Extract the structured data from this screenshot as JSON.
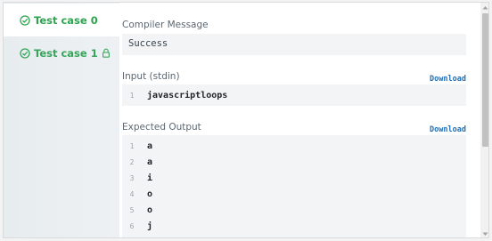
{
  "tabs": [
    {
      "label": "Test case 0",
      "icon": "check-circle-icon",
      "active": true
    },
    {
      "label": "Test case 1",
      "icon": "check-circle-icon",
      "locked": true
    }
  ],
  "compiler": {
    "label": "Compiler Message",
    "value": "Success"
  },
  "input": {
    "label": "Input (stdin)",
    "download": "Download",
    "lines": [
      {
        "num": "1",
        "text": "javascriptloops"
      }
    ]
  },
  "expected": {
    "label": "Expected Output",
    "download": "Download",
    "lines": [
      {
        "num": "1",
        "text": "a"
      },
      {
        "num": "2",
        "text": "a"
      },
      {
        "num": "3",
        "text": "i"
      },
      {
        "num": "4",
        "text": "o"
      },
      {
        "num": "5",
        "text": "o"
      },
      {
        "num": "6",
        "text": "j"
      }
    ]
  },
  "colors": {
    "success": "#2ea44f",
    "link": "#1f6fb5",
    "box": "#f2f4f5"
  }
}
